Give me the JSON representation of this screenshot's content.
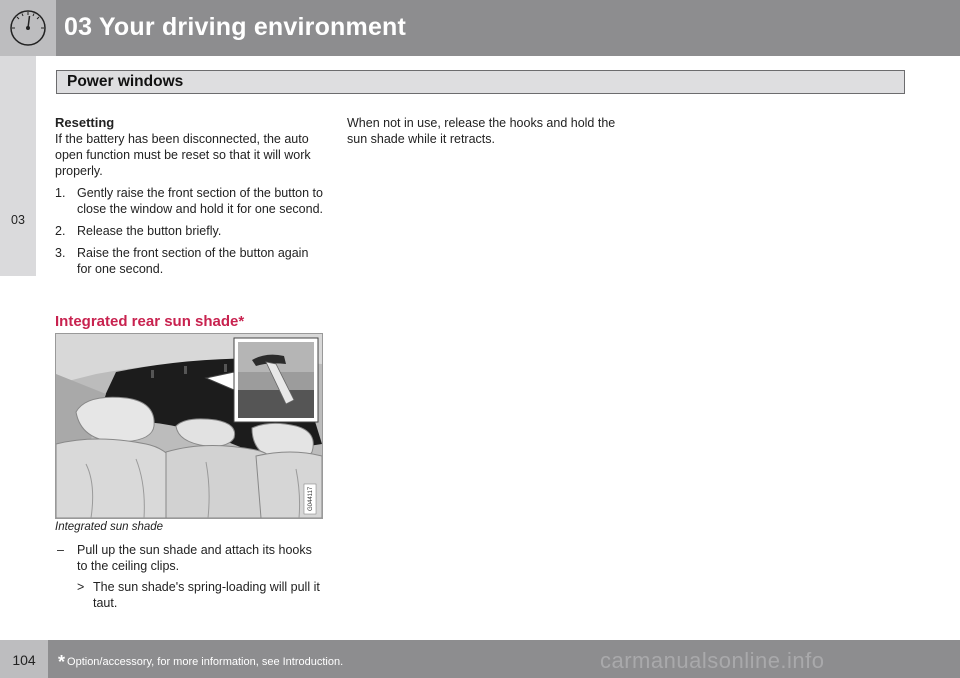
{
  "header": {
    "chapter_title": "03 Your driving environment",
    "section_title": "Power windows"
  },
  "side_tab": {
    "label": "03"
  },
  "left_column": {
    "heading": "Resetting",
    "intro": "If the battery has been disconnected, the auto open function must be reset so that it will work properly.",
    "steps": [
      {
        "num": "1.",
        "text": "Gently raise the front section of the button to close the window and hold it for one second."
      },
      {
        "num": "2.",
        "text": "Release the button briefly."
      },
      {
        "num": "3.",
        "text": "Raise the front section of the button again for one second."
      }
    ],
    "sub_heading": "Integrated rear sun shade*",
    "figure_code": "G044117",
    "caption": "Integrated sun shade",
    "bullet": {
      "dash": "–",
      "text": "Pull up the sun shade and attach its hooks to the ceiling clips."
    },
    "sub_bullet": {
      "marker": ">",
      "text": "The sun shade's spring-loading will pull it taut."
    }
  },
  "right_column": {
    "text": "When not in use, release the hooks and hold the sun shade while it retracts."
  },
  "footer": {
    "page_number": "104",
    "footnote_star": "*",
    "footnote_text": "Option/accessory, for more information, see Introduction.",
    "watermark": "carmanualsonline.info"
  }
}
